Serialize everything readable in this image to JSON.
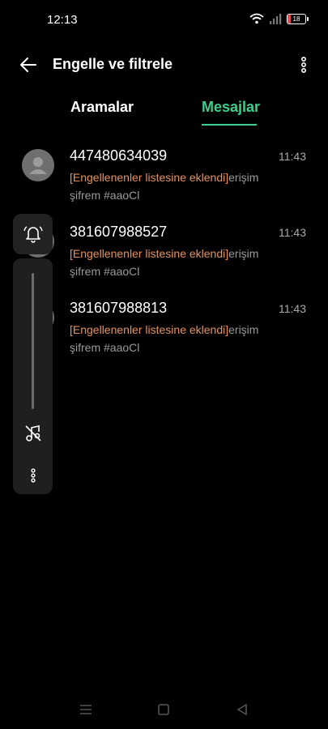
{
  "status": {
    "time": "12:13",
    "battery": "18"
  },
  "header": {
    "title": "Engelle ve filtrele"
  },
  "tabs": [
    {
      "label": "Aramalar"
    },
    {
      "label": "Mesajlar"
    }
  ],
  "messages": [
    {
      "sender": "447480634039",
      "time": "11:43",
      "tag": "[Engellenenler listesine eklendi]",
      "text": "erişim şifrem #aaoCl"
    },
    {
      "sender": "381607988527",
      "time": "11:43",
      "tag": "[Engellenenler listesine eklendi]",
      "text": "erişim şifrem #aaoCl"
    },
    {
      "sender": "381607988813",
      "time": "11:43",
      "tag": "[Engellenenler listesine eklendi]",
      "text": "erişim şifrem #aaoCl"
    }
  ],
  "colors": {
    "accent": "#3ccf8e",
    "tag": "#e5925b",
    "background": "#000000"
  },
  "icons": [
    "back-arrow-icon",
    "more-vertical-icon",
    "bell-icon",
    "music-note-off-icon",
    "recents-icon",
    "home-icon",
    "back-triangle-icon"
  ]
}
